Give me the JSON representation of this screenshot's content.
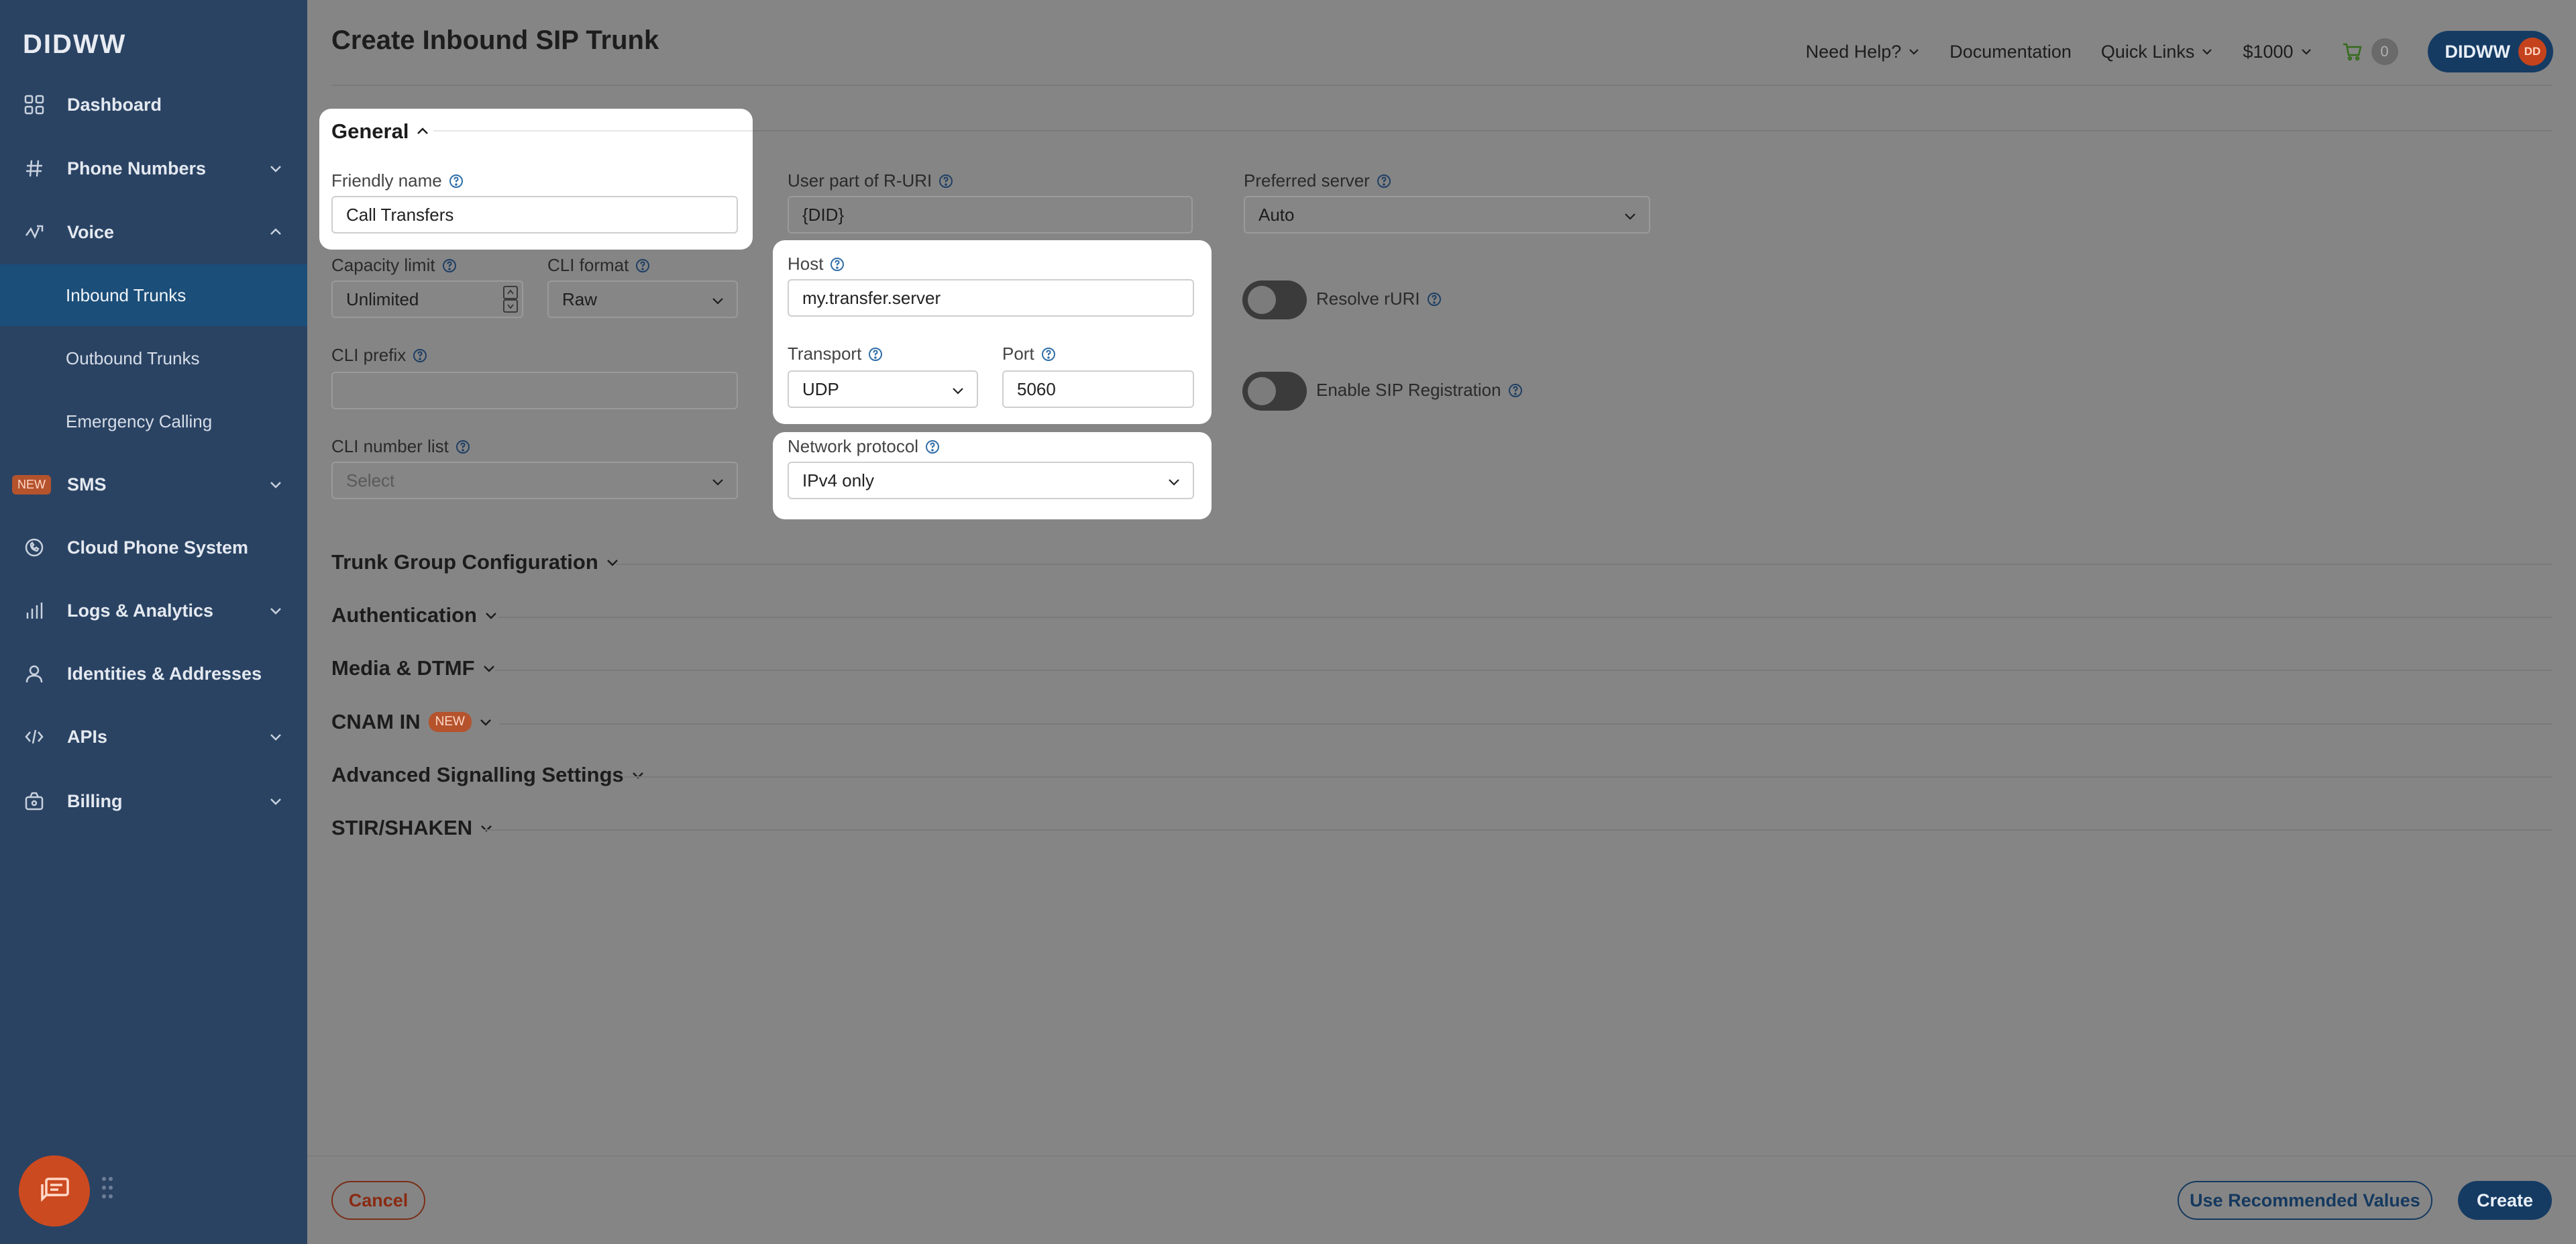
{
  "brand": {
    "logo": "DIDWW"
  },
  "sidebar": {
    "items": [
      {
        "label": "Dashboard",
        "icon": "grid-icon"
      },
      {
        "label": "Phone Numbers",
        "icon": "hash-icon"
      },
      {
        "label": "Voice",
        "icon": "voice-icon"
      },
      {
        "label": "Inbound Trunks"
      },
      {
        "label": "Outbound Trunks"
      },
      {
        "label": "Emergency Calling"
      },
      {
        "label": "SMS",
        "badge": "NEW"
      },
      {
        "label": "Cloud Phone System",
        "icon": "phone-icon"
      },
      {
        "label": "Logs & Analytics",
        "icon": "bar-chart-icon"
      },
      {
        "label": "Identities & Addresses",
        "icon": "user-icon"
      },
      {
        "label": "APIs",
        "icon": "code-icon"
      },
      {
        "label": "Billing",
        "icon": "wallet-icon"
      }
    ]
  },
  "header": {
    "title": "Create Inbound SIP Trunk",
    "need_help": "Need Help?",
    "documentation": "Documentation",
    "quick_links": "Quick Links",
    "balance": "$1000",
    "cart_count": "0",
    "user": "DIDWW",
    "avatar": "DD"
  },
  "general": {
    "title": "General",
    "friendly_name": {
      "label": "Friendly name",
      "value": "Call Transfers"
    },
    "user_part": {
      "label": "User part of R-URI",
      "value": "{DID}"
    },
    "preferred_server": {
      "label": "Preferred server",
      "value": "Auto"
    },
    "capacity_limit": {
      "label": "Capacity limit",
      "value": "Unlimited"
    },
    "cli_format": {
      "label": "CLI format",
      "value": "Raw"
    },
    "host": {
      "label": "Host",
      "value": "my.transfer.server"
    },
    "resolve_ruri": {
      "label": "Resolve rURI"
    },
    "cli_prefix": {
      "label": "CLI prefix",
      "value": ""
    },
    "transport": {
      "label": "Transport",
      "value": "UDP"
    },
    "port": {
      "label": "Port",
      "value": "5060"
    },
    "enable_sip": {
      "label": "Enable SIP Registration"
    },
    "cli_number_list": {
      "label": "CLI number list",
      "placeholder": "Select"
    },
    "network_protocol": {
      "label": "Network protocol",
      "value": "IPv4 only"
    }
  },
  "sections": [
    {
      "label": "Trunk Group Configuration"
    },
    {
      "label": "Authentication"
    },
    {
      "label": "Media & DTMF"
    },
    {
      "label": "CNAM IN",
      "badge": "NEW"
    },
    {
      "label": "Advanced Signalling Settings"
    },
    {
      "label": "STIR/SHAKEN"
    }
  ],
  "footer": {
    "cancel": "Cancel",
    "recommended": "Use Recommended Values",
    "create": "Create"
  }
}
